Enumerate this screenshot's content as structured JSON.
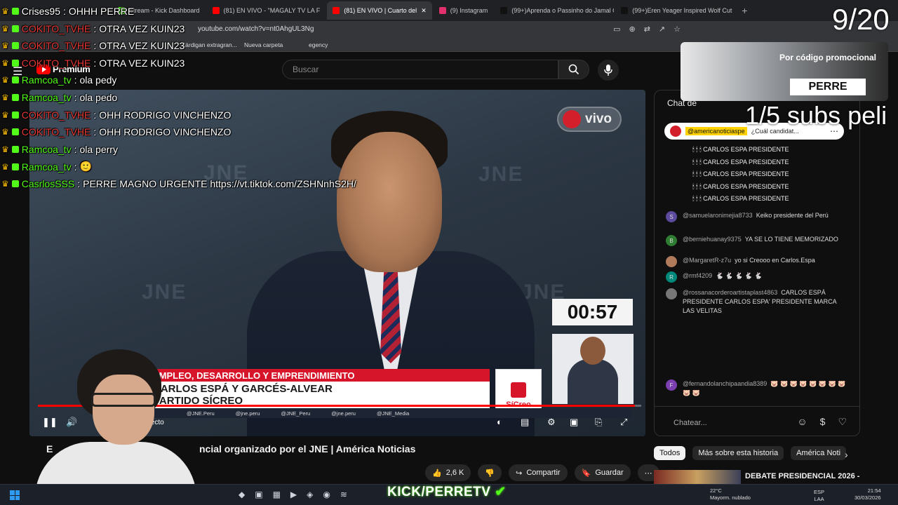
{
  "browser": {
    "tabs": [
      {
        "label": "Stream - Kick Dashboard",
        "color": "#53fc18",
        "active": false
      },
      {
        "label": "(81) EN VIVO - \"MAGALY TV LA F",
        "color": "#ff0000",
        "active": false
      },
      {
        "label": "(81) EN VIVO | Cuarto del",
        "color": "#ff0000",
        "active": true
      },
      {
        "label": "(9) Instagram",
        "color": "#e1306c",
        "active": false
      },
      {
        "label": "(99+)Aprenda o Passinho do Jamal C",
        "color": "#111111",
        "active": false
      },
      {
        "label": "(99+)Eren Yeager Inspired Wolf Cut",
        "color": "#111111",
        "active": false
      }
    ],
    "new_tab": "+",
    "url": "youtube.com/watch?v=nt0AhgUL3Ng",
    "bookmarks": [
      "Cárdigan extragran...",
      "Nueva carpeta",
      "egency"
    ]
  },
  "youtube": {
    "logo_text": "Premium",
    "search_placeholder": "Buscar",
    "live_badge": "vivo",
    "timer": "00:57",
    "lower_third_topic": "EMPLEO, DESARROLLO Y EMPRENDIMIENTO",
    "lower_third_line1": "CARLOS ESPÁ Y GARCÉS-ALVEAR",
    "lower_third_line2": "PARTIDO SÍCREO",
    "party_logo_text": "SíCreo",
    "socials": [
      "@JNE.Peru",
      "@jne.peru",
      "@JNE_Peru",
      "@jne.peru",
      "@JNE_Media"
    ],
    "live_label": "Directo",
    "progress": 0.99,
    "video_title_left": "E",
    "video_title": "ncial organizado por el JNE | América Noticias",
    "actions": {
      "like_count": "2,6 K",
      "share": "Compartir",
      "save": "Guardar"
    },
    "filters": [
      "Todos",
      "Más sobre esta historia",
      "América Noti"
    ],
    "related_title": "DEBATE PRESIDENCIAL 2026 -"
  },
  "chat": {
    "title": "Chat de",
    "pinned_user": "@americanoticiaspe",
    "pinned_text": "¿Cuál candidat...",
    "candle_lines": [
      "CARLOS ESPA PRESIDENTE",
      "CARLOS ESPA PRESIDENTE",
      "CARLOS ESPA PRESIDENTE",
      "CARLOS ESPA PRESIDENTE",
      "CARLOS ESPA PRESIDENTE"
    ],
    "messages": [
      {
        "avatar": "S",
        "color": "#5c4a9e",
        "author": "@samuelaronimejia8733",
        "text": "Keiko presidente del Perú"
      },
      {
        "avatar": "B",
        "color": "#2e7d32",
        "author": "@berniehuanay9375",
        "text": "YA SE LO TIENE MEMORIZADO"
      },
      {
        "avatar": "",
        "color": "#b07b5a",
        "author": "@MargaretR-z7u",
        "text": "yo si Creooo en Carlos.Espa"
      },
      {
        "avatar": "R",
        "color": "#00897b",
        "author": "@rmf4209",
        "text": "🐇 🐇 🐇 🐇 🐇"
      },
      {
        "avatar": "",
        "color": "#777777",
        "author": "@rossanacorderoartistaplast4863",
        "text": "CARLOS ESPÁ PRESIDENTE  CARLOS ESPA' PRESIDENTE  MARCA LAS VELITAS"
      },
      {
        "avatar": "F",
        "color": "#7b3fb0",
        "author": "@fernandolanchipaandia8389",
        "text": "🐷 🐷 🐷 🐷 🐷 🐷 🐷 🐷 🐷 🐷"
      }
    ],
    "input_placeholder": "Chatear..."
  },
  "overlay": {
    "counter": "9/20",
    "promo_text": "Por código promocional",
    "promo_code": "PERRE",
    "subs_text": "1/5 subs peli",
    "kick_brand": "KICK/PERRETV",
    "kick_chat": [
      {
        "user": "Crises95",
        "color": "#ffffff",
        "text": "OHHH PERRE"
      },
      {
        "user": "COKITO_TVHE",
        "color": "#e53935",
        "text": "OTRA VEZ KUIN23"
      },
      {
        "user": "COKITO_TVHE",
        "color": "#e53935",
        "text": "OTRA VEZ KUIN23"
      },
      {
        "user": "COKITO_TVHE",
        "color": "#e53935",
        "text": "OTRA VEZ KUIN23"
      },
      {
        "user": "Ramcoa_tv",
        "color": "#53fc18",
        "text": "ola pedy"
      },
      {
        "user": "Ramcoa_tv",
        "color": "#53fc18",
        "text": "ola pedo"
      },
      {
        "user": "COKITO_TVHE",
        "color": "#e53935",
        "text": "OHH RODRIGO VINCHENZO"
      },
      {
        "user": "COKITO_TVHE",
        "color": "#e53935",
        "text": "OHH RODRIGO VINCHENZO"
      },
      {
        "user": "Ramcoa_tv",
        "color": "#53fc18",
        "text": "ola perry"
      },
      {
        "user": "Ramcoa_tv",
        "color": "#53fc18",
        "text": "🙂"
      },
      {
        "user": "CasrlosSSS",
        "color": "#53fc18",
        "text": "PERRE MAGNO URGENTE https://vt.tiktok.com/ZSHNnhS2H/"
      }
    ]
  },
  "taskbar": {
    "weather_temp": "22°C",
    "weather_desc": "Mayorm. nublado",
    "lang": "ESP",
    "lang2": "LAA",
    "time": "21:54",
    "date": "30/03/2026"
  }
}
